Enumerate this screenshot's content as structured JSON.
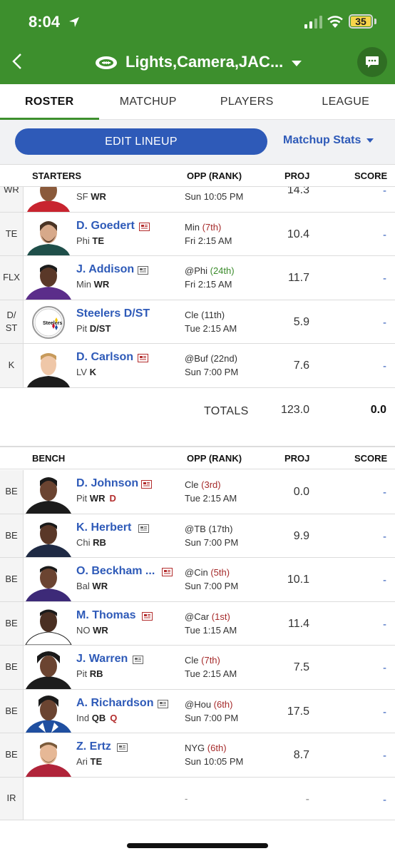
{
  "status_bar": {
    "time": "8:04",
    "battery": "35"
  },
  "header": {
    "team_name": "Lights,Camera,JAC..."
  },
  "tabs": [
    "ROSTER",
    "MATCHUP",
    "PLAYERS",
    "LEAGUE"
  ],
  "actions": {
    "edit_lineup": "EDIT LINEUP",
    "matchup_stats": "Matchup Stats"
  },
  "starters_header": {
    "label": "STARTERS",
    "opp": "OPP (RANK)",
    "proj": "PROJ",
    "score": "SCORE"
  },
  "starters": [
    {
      "slot": "WR",
      "name": "",
      "team": "SF",
      "pos": "WR",
      "status": "",
      "opp": "",
      "rank": "",
      "time": "Sun 10:05 PM",
      "proj": "14.3",
      "score": "-"
    },
    {
      "slot": "TE",
      "name": "D. Goedert",
      "team": "Phi",
      "pos": "TE",
      "status": "",
      "opp": "Min",
      "rank": "(7th)",
      "time": "Fri 2:15 AM",
      "proj": "10.4",
      "score": "-"
    },
    {
      "slot": "FLX",
      "name": "J. Addison",
      "team": "Min",
      "pos": "WR",
      "status": "",
      "opp": "@Phi",
      "rank": "(24th)",
      "time": "Fri 2:15 AM",
      "proj": "11.7",
      "score": "-"
    },
    {
      "slot": "D/ ST",
      "name": "Steelers D/ST",
      "team": "Pit",
      "pos": "D/ST",
      "status": "",
      "opp": "Cle",
      "rank": "(11th)",
      "time": "Tue 2:15 AM",
      "proj": "5.9",
      "score": "-"
    },
    {
      "slot": "K",
      "name": "D. Carlson",
      "team": "LV",
      "pos": "K",
      "status": "",
      "opp": "@Buf",
      "rank": "(22nd)",
      "time": "Sun 7:00 PM",
      "proj": "7.6",
      "score": "-"
    }
  ],
  "totals": {
    "label": "TOTALS",
    "proj": "123.0",
    "score": "0.0"
  },
  "bench_header": {
    "label": "BENCH",
    "opp": "OPP (RANK)",
    "proj": "PROJ",
    "score": "SCORE"
  },
  "bench": [
    {
      "slot": "BE",
      "name": "D. Johnson",
      "team": "Pit",
      "pos": "WR",
      "status": "D",
      "opp": "Cle",
      "rank": "(3rd)",
      "time": "Tue 2:15 AM",
      "proj": "0.0",
      "score": "-"
    },
    {
      "slot": "BE",
      "name": "K. Herbert",
      "team": "Chi",
      "pos": "RB",
      "status": "",
      "opp": "@TB",
      "rank": "(17th)",
      "time": "Sun 7:00 PM",
      "proj": "9.9",
      "score": "-"
    },
    {
      "slot": "BE",
      "name": "O. Beckham ...",
      "team": "Bal",
      "pos": "WR",
      "status": "",
      "opp": "@Cin",
      "rank": "(5th)",
      "time": "Sun 7:00 PM",
      "proj": "10.1",
      "score": "-"
    },
    {
      "slot": "BE",
      "name": "M. Thomas",
      "team": "NO",
      "pos": "WR",
      "status": "",
      "opp": "@Car",
      "rank": "(1st)",
      "time": "Tue 1:15 AM",
      "proj": "11.4",
      "score": "-"
    },
    {
      "slot": "BE",
      "name": "J. Warren",
      "team": "Pit",
      "pos": "RB",
      "status": "",
      "opp": "Cle",
      "rank": "(7th)",
      "time": "Tue 2:15 AM",
      "proj": "7.5",
      "score": "-"
    },
    {
      "slot": "BE",
      "name": "A. Richardson",
      "team": "Ind",
      "pos": "QB",
      "status": "Q",
      "opp": "@Hou",
      "rank": "(6th)",
      "time": "Sun 7:00 PM",
      "proj": "17.5",
      "score": "-"
    },
    {
      "slot": "BE",
      "name": "Z. Ertz",
      "team": "Ari",
      "pos": "TE",
      "status": "",
      "opp": "NYG",
      "rank": "(6th)",
      "time": "Sun 10:05 PM",
      "proj": "8.7",
      "score": "-"
    },
    {
      "slot": "IR",
      "name": "",
      "team": "",
      "pos": "",
      "status": "",
      "opp": "-",
      "rank": "",
      "time": "",
      "proj": "-",
      "score": "-"
    }
  ],
  "colors": {
    "header_green": "#3d8f2d",
    "link_blue": "#2e5ab8",
    "rank_red": "#a52a2a",
    "rank_green": "#3a8a2a"
  }
}
